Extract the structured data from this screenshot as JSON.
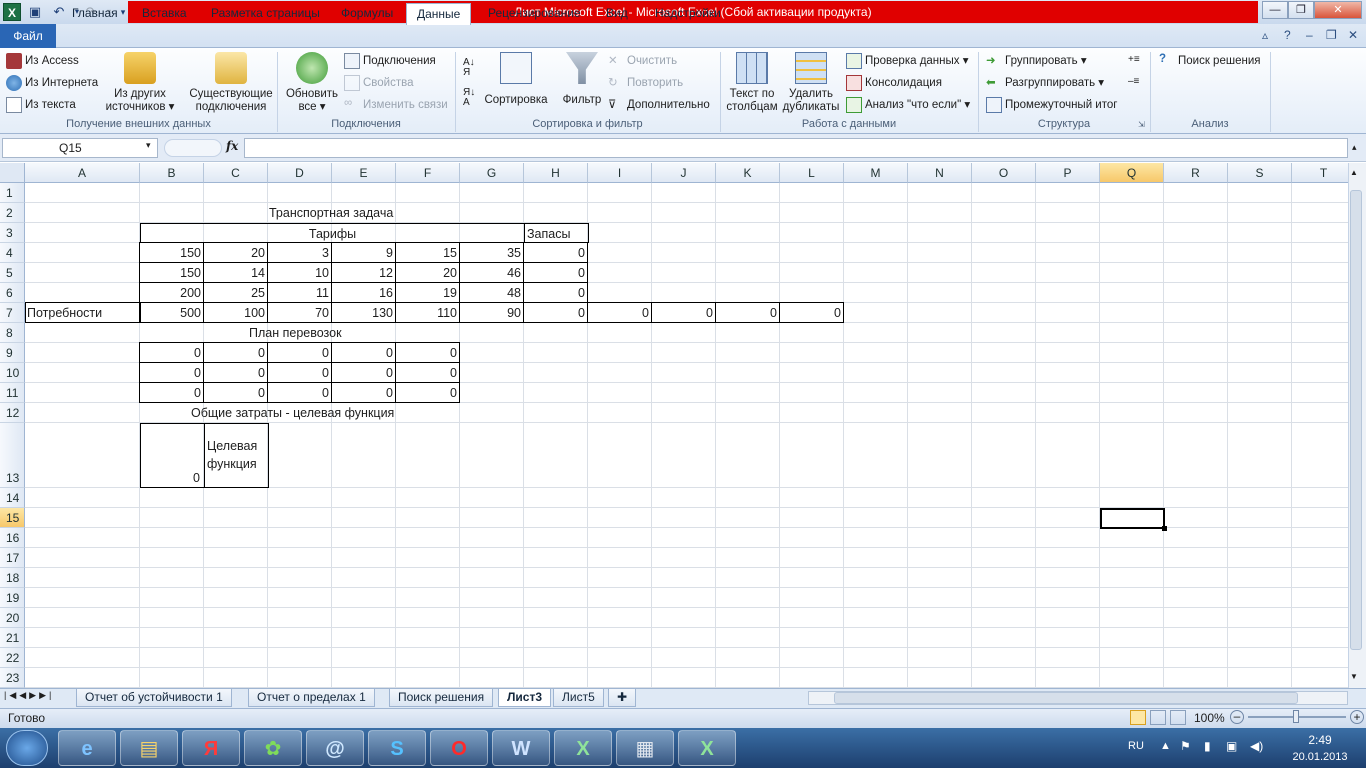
{
  "window": {
    "title": "Лист Microsoft Excel  -  Microsoft Excel (Сбой активации продукта)"
  },
  "ribbon_tabs": [
    "Файл",
    "Главная",
    "Вставка",
    "Разметка страницы",
    "Формулы",
    "Данные",
    "Рецензирование",
    "Вид",
    "Надстройки"
  ],
  "groups": {
    "external": {
      "label": "Получение внешних данных",
      "access": "Из Access",
      "web": "Из Интернета",
      "text": "Из текста",
      "other_l1": "Из других",
      "other_l2": "источников",
      "existing_l1": "Существующие",
      "existing_l2": "подключения"
    },
    "connections": {
      "label": "Подключения",
      "refresh_l1": "Обновить",
      "refresh_l2": "все",
      "conn": "Подключения",
      "props": "Свойства",
      "links": "Изменить связи"
    },
    "sort": {
      "label": "Сортировка и фильтр",
      "sort": "Сортировка",
      "filter": "Фильтр",
      "clear": "Очистить",
      "reapply": "Повторить",
      "advanced": "Дополнительно"
    },
    "datatools": {
      "label": "Работа с данными",
      "t2c_l1": "Текст по",
      "t2c_l2": "столбцам",
      "dup_l1": "Удалить",
      "dup_l2": "дубликаты",
      "validation": "Проверка данных",
      "consolidate": "Консолидация",
      "whatif": "Анализ \"что если\""
    },
    "outline": {
      "label": "Структура",
      "group": "Группировать",
      "ungroup": "Разгруппировать",
      "subtotal": "Промежуточный итог"
    },
    "analysis": {
      "label": "Анализ",
      "solver": "Поиск решения"
    }
  },
  "formula_bar": {
    "name_box": "Q15",
    "fx": "fx",
    "formula": ""
  },
  "columns": [
    "A",
    "B",
    "C",
    "D",
    "E",
    "F",
    "G",
    "H",
    "I",
    "J",
    "K",
    "L",
    "M",
    "N",
    "O",
    "P",
    "Q",
    "R",
    "S",
    "T"
  ],
  "rows": [
    "1",
    "2",
    "3",
    "4",
    "5",
    "6",
    "7",
    "8",
    "9",
    "10",
    "11",
    "12",
    "13",
    "14",
    "15",
    "16",
    "17",
    "18",
    "19",
    "20",
    "21",
    "22",
    "23"
  ],
  "selected_cell": "Q15",
  "cells": {
    "title": "Транспортная задача",
    "tariffs": "Тарифы",
    "supplies": "Запасы",
    "tariff_rows": [
      [
        "150",
        "20",
        "3",
        "9",
        "15",
        "35",
        "0"
      ],
      [
        "150",
        "14",
        "10",
        "12",
        "20",
        "46",
        "0"
      ],
      [
        "200",
        "25",
        "11",
        "16",
        "19",
        "48",
        "0"
      ]
    ],
    "needs_label": "Потребности",
    "needs": [
      "500",
      "100",
      "70",
      "130",
      "110",
      "90",
      "0",
      "0",
      "0",
      "0",
      "0"
    ],
    "plan": "План перевозок",
    "plan_rows": [
      [
        "0",
        "0",
        "0",
        "0",
        "0"
      ],
      [
        "0",
        "0",
        "0",
        "0",
        "0"
      ],
      [
        "0",
        "0",
        "0",
        "0",
        "0"
      ]
    ],
    "total": "Общие затраты - целевая функция",
    "total_value": "0",
    "target_l1": "Целевая",
    "target_l2": "функция"
  },
  "sheet_tabs": [
    "Отчет об устойчивости 1",
    "Отчет о пределах 1",
    "Поиск решения",
    "Лист3",
    "Лист5"
  ],
  "active_sheet": "Лист3",
  "status": {
    "ready": "Готово",
    "zoom": "100%"
  },
  "taskbar": {
    "lang": "RU",
    "time": "2:49",
    "date": "20.01.2013"
  }
}
